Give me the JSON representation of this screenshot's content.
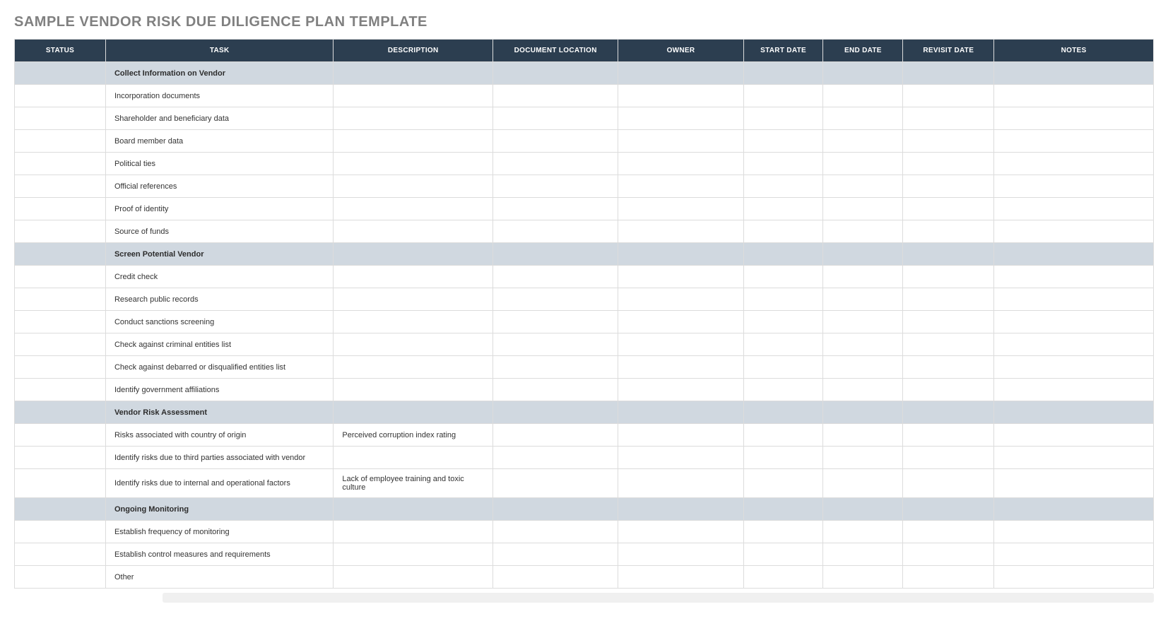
{
  "title": "SAMPLE VENDOR RISK DUE DILIGENCE PLAN TEMPLATE",
  "columns": {
    "status": "STATUS",
    "task": "TASK",
    "description": "DESCRIPTION",
    "doc_location": "DOCUMENT LOCATION",
    "owner": "OWNER",
    "start_date": "START DATE",
    "end_date": "END DATE",
    "revisit_date": "REVISIT DATE",
    "notes": "NOTES"
  },
  "rows": [
    {
      "type": "section",
      "task": "Collect Information on Vendor"
    },
    {
      "type": "item",
      "task": "Incorporation documents",
      "description": ""
    },
    {
      "type": "item",
      "task": "Shareholder and beneficiary data",
      "description": ""
    },
    {
      "type": "item",
      "task": "Board member data",
      "description": ""
    },
    {
      "type": "item",
      "task": "Political ties",
      "description": ""
    },
    {
      "type": "item",
      "task": "Official references",
      "description": ""
    },
    {
      "type": "item",
      "task": "Proof of identity",
      "description": ""
    },
    {
      "type": "item",
      "task": "Source of funds",
      "description": ""
    },
    {
      "type": "section",
      "task": "Screen Potential Vendor"
    },
    {
      "type": "item",
      "task": "Credit check",
      "description": ""
    },
    {
      "type": "item",
      "task": "Research public records",
      "description": ""
    },
    {
      "type": "item",
      "task": "Conduct sanctions screening",
      "description": ""
    },
    {
      "type": "item",
      "task": "Check against criminal entities list",
      "description": ""
    },
    {
      "type": "item",
      "task": "Check against debarred or disqualified entities list",
      "description": ""
    },
    {
      "type": "item",
      "task": "Identify government affiliations",
      "description": ""
    },
    {
      "type": "section",
      "task": "Vendor Risk Assessment"
    },
    {
      "type": "item",
      "task": "Risks associated with country of origin",
      "description": "Perceived corruption index rating"
    },
    {
      "type": "item",
      "task": "Identify risks due to third parties associated with vendor",
      "description": ""
    },
    {
      "type": "item",
      "task": "Identify risks due to internal and operational factors",
      "description": "Lack of employee training and toxic culture"
    },
    {
      "type": "section",
      "task": "Ongoing Monitoring"
    },
    {
      "type": "item",
      "task": "Establish frequency of monitoring",
      "description": ""
    },
    {
      "type": "item",
      "task": "Establish control measures and requirements",
      "description": ""
    },
    {
      "type": "item",
      "task": "Other",
      "description": ""
    }
  ]
}
